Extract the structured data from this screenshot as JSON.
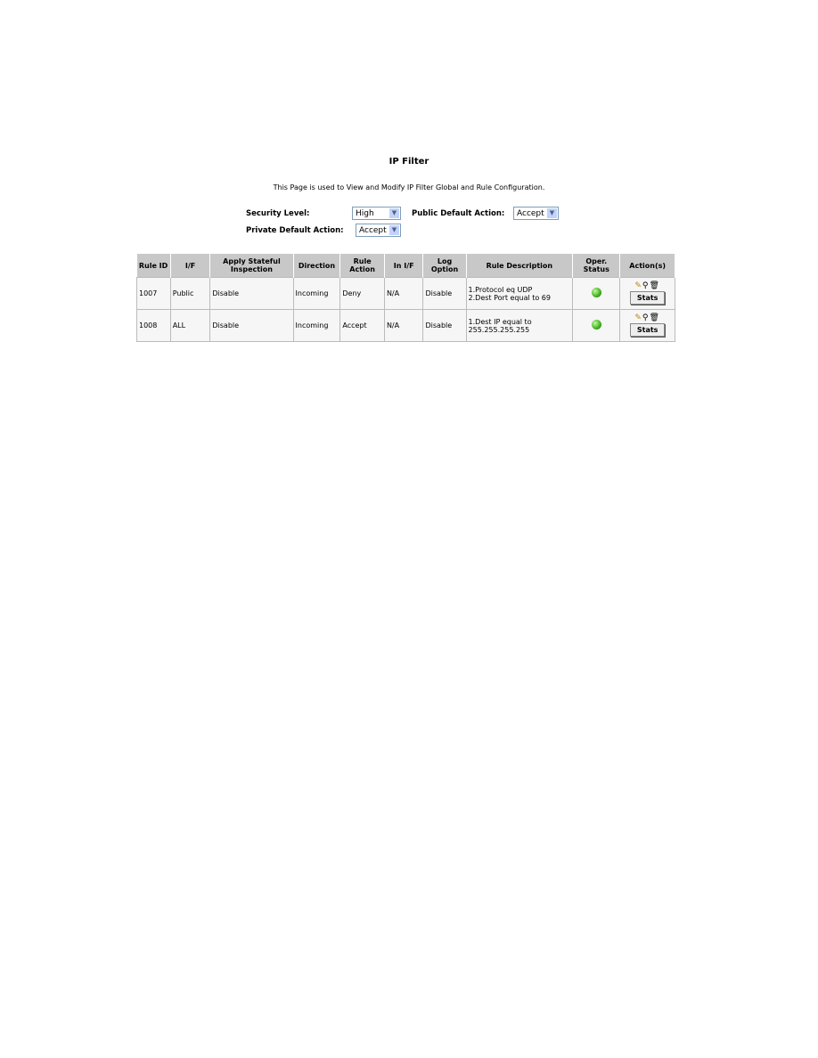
{
  "title": "IP Filter",
  "description": "This Page is used to View and Modify IP Filter Global and Rule Configuration.",
  "form": {
    "security_level_label": "Security Level:",
    "security_level": "High",
    "public_default_label": "Public Default Action:",
    "public_default": "Accept",
    "private_default_label": "Private Default Action:",
    "private_default": "Accept"
  },
  "table": {
    "headers": [
      "Rule ID",
      "I/F",
      "Apply Stateful Inspection",
      "Direction",
      "Rule Action",
      "In I/F",
      "Log Option",
      "Rule Description",
      "Oper. Status",
      "Action(s)"
    ],
    "rows": [
      {
        "id": "1007",
        "if": "Public",
        "stateful": "Disable",
        "direction": "Incoming",
        "action": "Deny",
        "in_if": "N/A",
        "log": "Disable",
        "desc1": "1.Protocol eq UDP",
        "desc2": "2.Dest Port equal to 69",
        "status": "green"
      },
      {
        "id": "1008",
        "if": "ALL",
        "stateful": "Disable",
        "direction": "Incoming",
        "action": "Accept",
        "in_if": "N/A",
        "log": "Disable",
        "desc1": "1.Dest IP equal to",
        "desc2": "255.255.255.255",
        "status": "green"
      }
    ],
    "stats_label": "Stats"
  }
}
